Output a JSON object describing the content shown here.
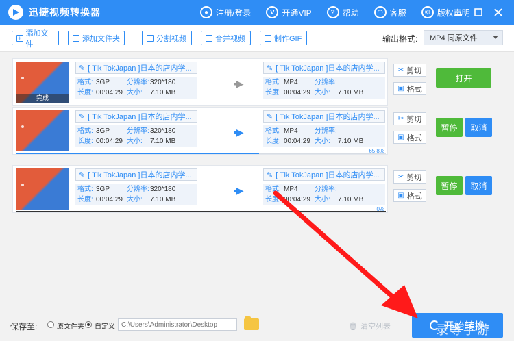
{
  "titlebar": {
    "title": "迅捷视频转换器",
    "nav": [
      {
        "label": "注册/登录",
        "icon": "user-icon"
      },
      {
        "label": "开通VIP",
        "icon": "vip-icon"
      },
      {
        "label": "帮助",
        "icon": "help-icon"
      },
      {
        "label": "客服",
        "icon": "headset-icon"
      },
      {
        "label": "版权声明",
        "icon": "copyright-icon"
      }
    ],
    "window_controls": [
      "minimize-icon",
      "maximize-icon",
      "close-icon"
    ]
  },
  "toolbar": {
    "buttons": [
      {
        "label": "添加文件",
        "icon": "plus-icon"
      },
      {
        "label": "添加文件夹",
        "icon": "folder-add-icon"
      },
      {
        "label": "分割视频",
        "icon": "split-icon"
      },
      {
        "label": "合并视频",
        "icon": "merge-icon"
      },
      {
        "label": "制作GIF",
        "icon": "gif-icon"
      }
    ],
    "output_format_label": "输出格式:",
    "output_format_value": "MP4 同原文件"
  },
  "rows": [
    {
      "thumb_badge": "完成",
      "src_name": "[ Tik TokJapan ]日本的店内学...",
      "src_format_label": "格式:",
      "src_format": "3GP",
      "src_res_label": "分辨率:",
      "src_res": "320*180",
      "src_duration_label": "长度:",
      "src_duration": "00:04:29",
      "src_size_label": "大小:",
      "src_size": "7.10 MB",
      "dst_name": "[ Tik TokJapan ]日本的店内学...",
      "dst_format_label": "格式:",
      "dst_format": "MP4",
      "dst_res_label": "分辨率:",
      "dst_res": "",
      "dst_duration_label": "长度:",
      "dst_duration": "00:04:29",
      "dst_size_label": "大小:",
      "dst_size": "7.10 MB",
      "cut_label": "剪切",
      "format_label": "格式",
      "primary_action": "打开",
      "progress_percent": null,
      "progress_text": ""
    },
    {
      "thumb_badge": "",
      "src_name": "[ Tik TokJapan ]日本的店内学...",
      "src_format_label": "格式:",
      "src_format": "3GP",
      "src_res_label": "分辨率:",
      "src_res": "320*180",
      "src_duration_label": "长度:",
      "src_duration": "00:04:29",
      "src_size_label": "大小:",
      "src_size": "7.10 MB",
      "dst_name": "[ Tik TokJapan ]日本的店内学...",
      "dst_format_label": "格式:",
      "dst_format": "MP4",
      "dst_res_label": "分辨率:",
      "dst_res": "",
      "dst_duration_label": "长度:",
      "dst_duration": "00:04:29",
      "dst_size_label": "大小:",
      "dst_size": "7.10 MB",
      "cut_label": "剪切",
      "format_label": "格式",
      "pause_label": "暂停",
      "cancel_label": "取消",
      "progress_percent": 65.8,
      "progress_text": "65.8%"
    },
    {
      "thumb_badge": "",
      "src_name": "[ Tik TokJapan ]日本的店内学...",
      "src_format_label": "格式:",
      "src_format": "3GP",
      "src_res_label": "分辨率:",
      "src_res": "320*180",
      "src_duration_label": "长度:",
      "src_duration": "00:04:29",
      "src_size_label": "大小:",
      "src_size": "7.10 MB",
      "dst_name": "[ Tik TokJapan ]日本的店内学...",
      "dst_format_label": "格式:",
      "dst_format": "MP4",
      "dst_res_label": "分辨率:",
      "dst_res": "",
      "dst_duration_label": "长度:",
      "dst_duration": "00:04:29",
      "dst_size_label": "大小:",
      "dst_size": "7.10 MB",
      "cut_label": "剪切",
      "format_label": "格式",
      "pause_label": "暂停",
      "cancel_label": "取消",
      "progress_percent": 0,
      "progress_text": "0%"
    }
  ],
  "bottombar": {
    "save_to_label": "保存至:",
    "radio_original": "原文件夹",
    "radio_custom": "自定义",
    "selected": "custom",
    "path_placeholder": "C:\\Users\\Administrator\\Desktop",
    "clear_label": "清空列表",
    "start_label": "开始转换"
  },
  "annotation": {
    "arrow_color": "#ff1a1a",
    "watermark": "录等手游"
  },
  "colors": {
    "brand": "#2f8df5",
    "green": "#4fba3a"
  }
}
